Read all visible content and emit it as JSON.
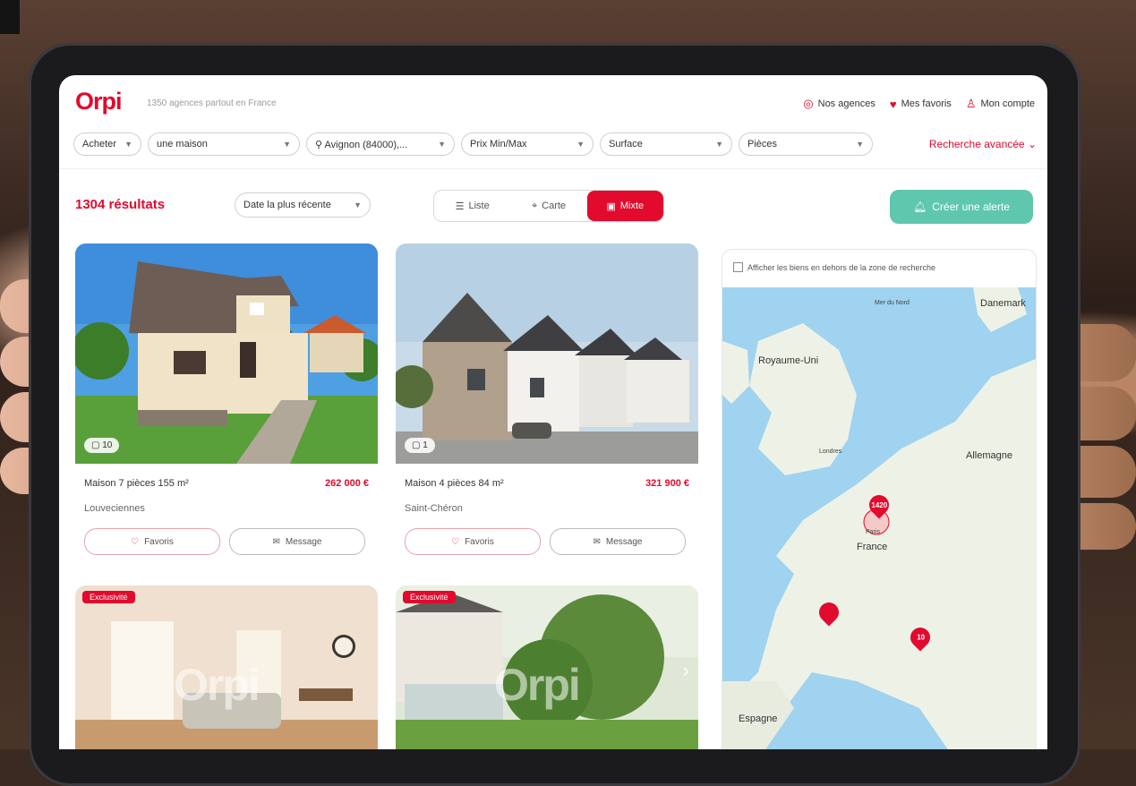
{
  "header": {
    "logo": "Orpi",
    "tagline": "1350 agences partout en France",
    "links": [
      {
        "label": "Nos agences",
        "icon": "location-pin-icon"
      },
      {
        "label": "Mes favoris",
        "icon": "heart-icon"
      },
      {
        "label": "Mon compte",
        "icon": "user-icon"
      }
    ]
  },
  "filters": {
    "transaction": "Acheter",
    "property_type": "une maison",
    "location": "Avignon (84000),...",
    "price": "Prix Min/Max",
    "surface": "Surface",
    "rooms": "Pièces",
    "advanced": "Recherche avancée"
  },
  "results": {
    "count": "1304 résultats",
    "sort": "Date la plus récente",
    "views": [
      {
        "label": "Liste",
        "icon": "list-icon",
        "active": false
      },
      {
        "label": "Carte",
        "icon": "map-icon",
        "active": false
      },
      {
        "label": "Mixte",
        "icon": "mixed-view-icon",
        "active": true
      }
    ],
    "create_alert": "Créer une alerte"
  },
  "listings": [
    {
      "title": "Maison 7 pièces 155 m²",
      "price": "262 000 €",
      "city": "Louveciennes",
      "photo_count": "10",
      "favorite_label": "Favoris",
      "message_label": "Message"
    },
    {
      "title": "Maison 4 pièces 84 m²",
      "price": "321 900 €",
      "city": "Saint-Chéron",
      "photo_count": "1",
      "favorite_label": "Favoris",
      "message_label": "Message"
    }
  ],
  "listings_row2": [
    {
      "badge": "Exclusivité",
      "watermark": "Orpi"
    },
    {
      "badge": "Exclusivité",
      "watermark": "Orpi"
    }
  ],
  "map": {
    "checkbox_label": "Afficher les biens en dehors de la zone de recherche",
    "labels": {
      "uk": "Royaume-Uni",
      "denmark": "Danemark",
      "germany": "Allemagne",
      "france": "France",
      "spain": "Espagne",
      "london": "Londres",
      "north_sea": "Mer du Nord",
      "paris": "Paris"
    },
    "pins": [
      "1420",
      "",
      "10"
    ],
    "colors": {
      "sea": "#9fd3ef",
      "land": "#eef2e6",
      "pin": "#e20a2d"
    }
  }
}
